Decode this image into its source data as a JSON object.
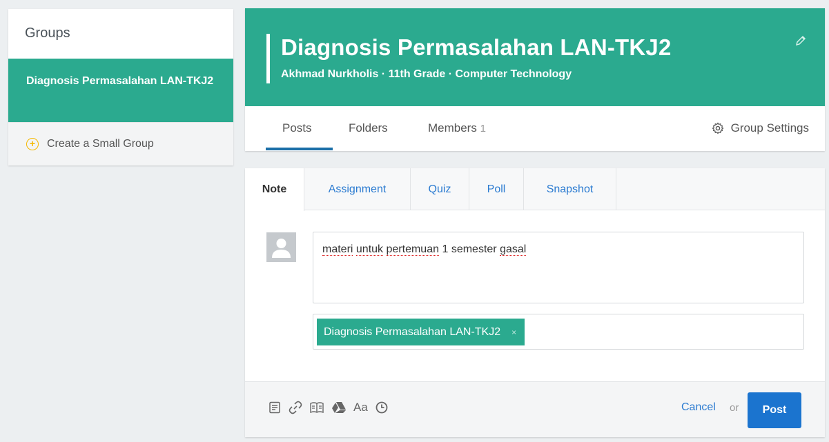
{
  "sidebar": {
    "title": "Groups",
    "group_name": "Diagnosis Permasalahan LAN-TKJ2",
    "create_label": "Create a Small Group"
  },
  "banner": {
    "title": "Diagnosis Permasalahan LAN-TKJ2",
    "subtitle": "Akhmad Nurkholis · 11th Grade · Computer Technology",
    "color": "#2baa8f"
  },
  "tabs": {
    "posts": "Posts",
    "folders": "Folders",
    "members": "Members",
    "members_count": "1",
    "settings": "Group Settings"
  },
  "post_tabs": {
    "note": "Note",
    "assignment": "Assignment",
    "quiz": "Quiz",
    "poll": "Poll",
    "snapshot": "Snapshot"
  },
  "composer": {
    "note_words": [
      "materi",
      "untuk",
      "pertemuan",
      "1",
      "semester",
      "gasal"
    ],
    "tag_label": "Diagnosis Permasalahan LAN-TKJ2",
    "tag_remove": "×",
    "format_label": "Aa",
    "cancel_label": "Cancel",
    "or_label": "or",
    "post_label": "Post"
  },
  "icons": [
    "edit-icon",
    "gear-icon",
    "plus-circle-icon",
    "avatar-icon",
    "note-icon",
    "link-icon",
    "library-icon",
    "drive-icon",
    "format-icon",
    "clock-icon"
  ],
  "colors": {
    "accent": "#2baa8f",
    "link": "#2b7bd1",
    "primary_button": "#1b74cf",
    "create_plus": "#f5b800"
  }
}
